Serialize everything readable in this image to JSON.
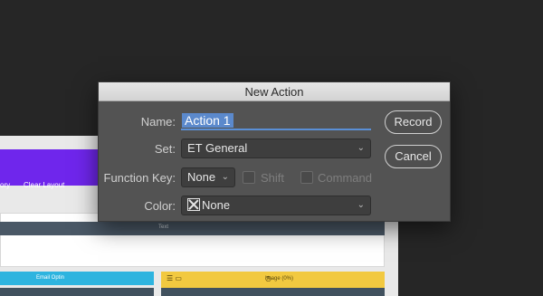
{
  "background": {
    "builder_left_partial": "ory",
    "clear_layout": "Clear Layout",
    "text_module": "Text",
    "email_optin": "Email Optin",
    "image_module": "Image (0%)"
  },
  "dialog": {
    "title": "New Action",
    "name_label": "Name:",
    "name_value": "Action 1",
    "set_label": "Set:",
    "set_value": "ET General",
    "function_key_label": "Function Key:",
    "function_key_value": "None",
    "shift_label": "Shift",
    "command_label": "Command",
    "color_label": "Color:",
    "color_value": "None",
    "record_button": "Record",
    "cancel_button": "Cancel"
  }
}
